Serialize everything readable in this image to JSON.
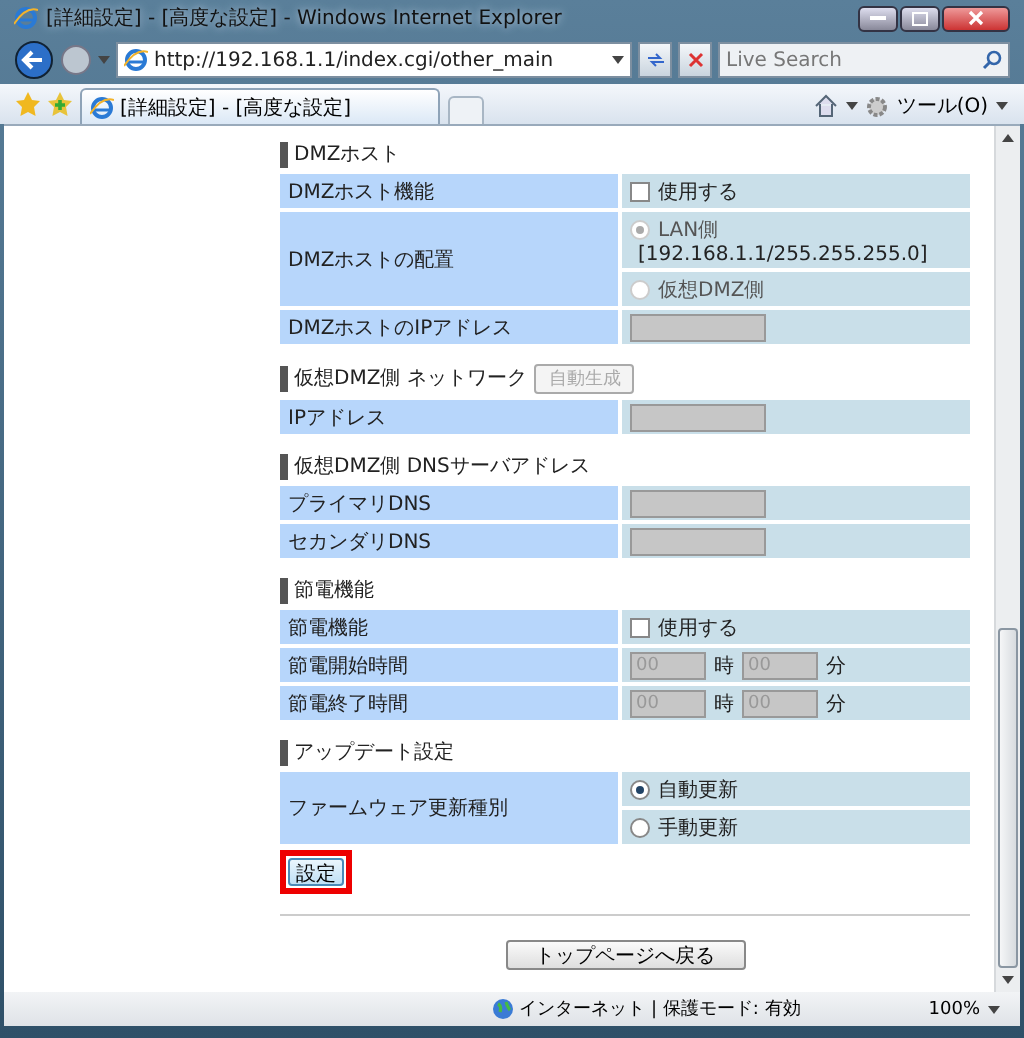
{
  "window": {
    "title": "[詳細設定] - [高度な設定] - Windows Internet Explorer"
  },
  "address_bar": {
    "url": "http://192.168.1.1/index.cgi/other_main"
  },
  "search": {
    "placeholder": "Live Search"
  },
  "tabs": [
    {
      "label": "[詳細設定] - [高度な設定]",
      "selected": true
    }
  ],
  "tools_menu": "ツール(O)",
  "sections": [
    {
      "title": "DMZホスト",
      "rows": [
        {
          "label": "DMZホスト機能",
          "kind": "checkbox",
          "option": "使用する",
          "checked": false
        },
        {
          "label": "DMZホストの配置",
          "kind": "radio",
          "options": [
            {
              "label": "LAN側",
              "detail": "[192.168.1.1/255.255.255.0]",
              "selected": true,
              "disabled": true
            },
            {
              "label": "仮想DMZ側",
              "selected": false,
              "disabled": true
            }
          ]
        },
        {
          "label": "DMZホストのIPアドレス",
          "kind": "input",
          "disabled": true
        }
      ]
    },
    {
      "title": "仮想DMZ側 ネットワーク",
      "button": {
        "label": "自動生成",
        "disabled": true
      },
      "rows": [
        {
          "label": "IPアドレス",
          "kind": "input",
          "disabled": true
        }
      ]
    },
    {
      "title": "仮想DMZ側 DNSサーバアドレス",
      "rows": [
        {
          "label": "プライマリDNS",
          "kind": "input",
          "disabled": true
        },
        {
          "label": "セカンダリDNS",
          "kind": "input",
          "disabled": true
        }
      ]
    },
    {
      "title": "節電機能",
      "rows": [
        {
          "label": "節電機能",
          "kind": "checkbox",
          "option": "使用する",
          "checked": false
        },
        {
          "label": "節電開始時間",
          "kind": "time",
          "hour_placeholder": "00",
          "hour_unit": "時",
          "minute_placeholder": "00",
          "minute_unit": "分",
          "disabled": true
        },
        {
          "label": "節電終了時間",
          "kind": "time",
          "hour_placeholder": "00",
          "hour_unit": "時",
          "minute_placeholder": "00",
          "minute_unit": "分",
          "disabled": true
        }
      ]
    },
    {
      "title": "アップデート設定",
      "rows": [
        {
          "label": "ファームウェア更新種別",
          "kind": "radio",
          "options": [
            {
              "label": "自動更新",
              "selected": true,
              "disabled": false
            },
            {
              "label": "手動更新",
              "selected": false,
              "disabled": false
            }
          ]
        }
      ]
    }
  ],
  "submit_button": {
    "label": "設定",
    "highlighted": true
  },
  "back_button": "トップページへ戻る",
  "status_bar": {
    "zone": "インターネット | 保護モード: 有効",
    "zoom": "100%"
  }
}
